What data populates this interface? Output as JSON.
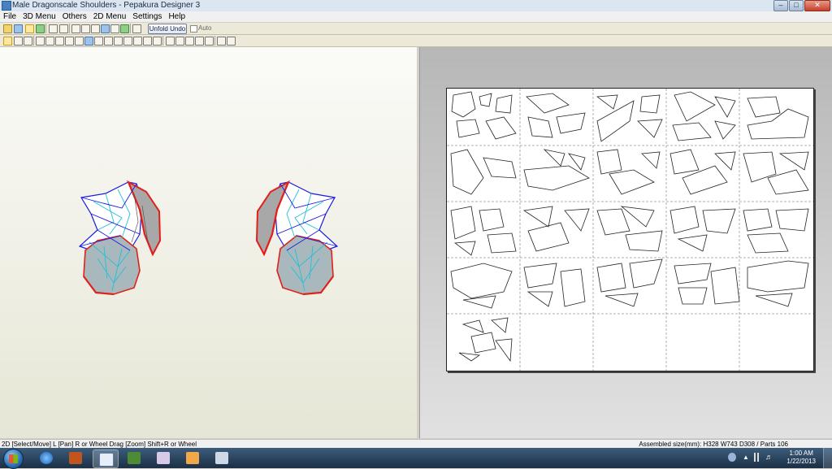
{
  "window": {
    "title": "Male Dragonscale Shoulders - Pepakura Designer 3"
  },
  "menu": {
    "items": [
      "File",
      "3D Menu",
      "Others",
      "2D Menu",
      "Settings",
      "Help"
    ]
  },
  "toolbar": {
    "unfold_undo_label": "Unfold Undo",
    "auto_label": "Auto"
  },
  "statusbar": {
    "left": "2D [Select/Move] L [Pan] R or Wheel Drag [Zoom] Shift+R or Wheel",
    "right": "Assembled size(mm): H328 W743 D308 / Parts 106"
  },
  "taskbar": {
    "time": "1:00 AM",
    "date": "1/22/2013"
  },
  "colors": {
    "model_edge_red": "#e0201a",
    "model_edge_blue": "#1a1ae0",
    "model_edge_cyan": "#22c0d8",
    "model_face_gray": "#9a9a9a"
  }
}
